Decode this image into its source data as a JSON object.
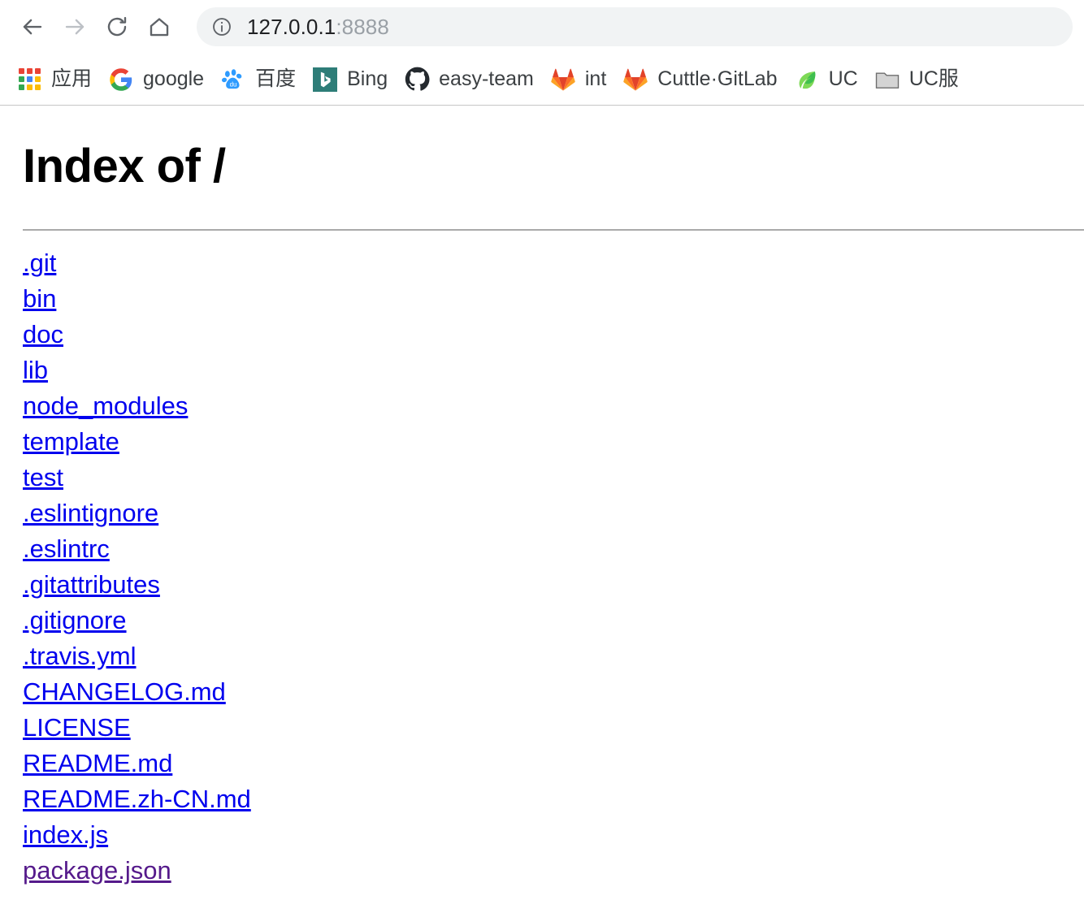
{
  "browser": {
    "toolbar": {
      "back_label": "Back",
      "forward_label": "Forward",
      "reload_label": "Reload",
      "home_label": "Home",
      "url_host": "127.0.0.1",
      "url_port": ":8888",
      "url_full": "127.0.0.1:8888",
      "site_info_label": "View site information"
    },
    "bookmarks": [
      {
        "label": "应用",
        "icon": "apps-grid-icon"
      },
      {
        "label": "google",
        "icon": "google-icon"
      },
      {
        "label": "百度",
        "icon": "baidu-icon"
      },
      {
        "label": "Bing",
        "icon": "bing-icon"
      },
      {
        "label": "easy-team",
        "icon": "github-icon"
      },
      {
        "label": "int",
        "icon": "gitlab-icon"
      },
      {
        "label": "Cuttle·GitLab",
        "icon": "gitlab-icon"
      },
      {
        "label": "UC",
        "icon": "uc-leaf-icon"
      },
      {
        "label": "UC服",
        "icon": "folder-icon"
      }
    ]
  },
  "page": {
    "title": "Index of /",
    "entries": [
      {
        "name": ".git",
        "visited": false
      },
      {
        "name": "bin",
        "visited": false
      },
      {
        "name": "doc",
        "visited": false
      },
      {
        "name": "lib",
        "visited": false
      },
      {
        "name": "node_modules",
        "visited": false
      },
      {
        "name": "template",
        "visited": false
      },
      {
        "name": "test",
        "visited": false
      },
      {
        "name": ".eslintignore",
        "visited": false
      },
      {
        "name": ".eslintrc",
        "visited": false
      },
      {
        "name": ".gitattributes",
        "visited": false
      },
      {
        "name": ".gitignore",
        "visited": false
      },
      {
        "name": ".travis.yml",
        "visited": false
      },
      {
        "name": "CHANGELOG.md",
        "visited": false
      },
      {
        "name": "LICENSE",
        "visited": false
      },
      {
        "name": "README.md",
        "visited": false
      },
      {
        "name": "README.zh-CN.md",
        "visited": false
      },
      {
        "name": "index.js",
        "visited": false
      },
      {
        "name": "package.json",
        "visited": true
      }
    ]
  },
  "colors": {
    "link": "#0000ee",
    "link_visited": "#551a8b",
    "omnibox_bg": "#f1f3f4",
    "url_text": "#202124",
    "url_port": "#9aa0a6",
    "divider": "#aaaaaa"
  }
}
